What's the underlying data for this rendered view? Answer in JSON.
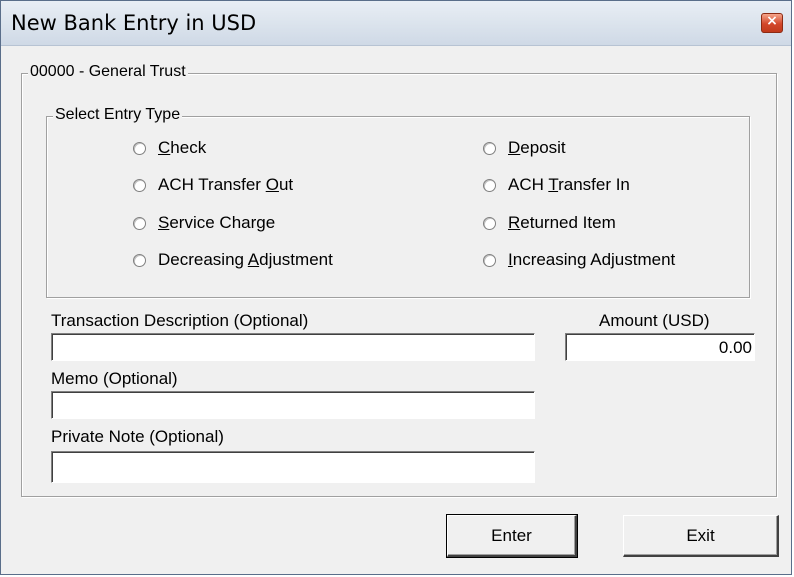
{
  "window": {
    "title": "New Bank Entry in USD",
    "close_label": "×"
  },
  "account_group": {
    "label": "00000 - General Trust"
  },
  "entry_type": {
    "label": "Select Entry Type",
    "left": [
      {
        "pre": "",
        "key": "C",
        "post": "heck"
      },
      {
        "pre": "ACH Transfer ",
        "key": "O",
        "post": "ut"
      },
      {
        "pre": "",
        "key": "S",
        "post": "ervice Charge"
      },
      {
        "pre": "Decreasing ",
        "key": "A",
        "post": "djustment"
      }
    ],
    "right": [
      {
        "pre": "",
        "key": "D",
        "post": "eposit"
      },
      {
        "pre": "ACH ",
        "key": "T",
        "post": "ransfer In"
      },
      {
        "pre": "",
        "key": "R",
        "post": "eturned Item"
      },
      {
        "pre": "",
        "key": "I",
        "post": "ncreasing Adjustment"
      }
    ]
  },
  "fields": {
    "description_label": "Transaction Description (Optional)",
    "description_value": "",
    "amount_label": "Amount (USD)",
    "amount_value": "0.00",
    "memo_label": "Memo (Optional)",
    "memo_value": "",
    "note_label": "Private Note (Optional)",
    "note_value": ""
  },
  "buttons": {
    "enter": "Enter",
    "exit": "Exit"
  }
}
